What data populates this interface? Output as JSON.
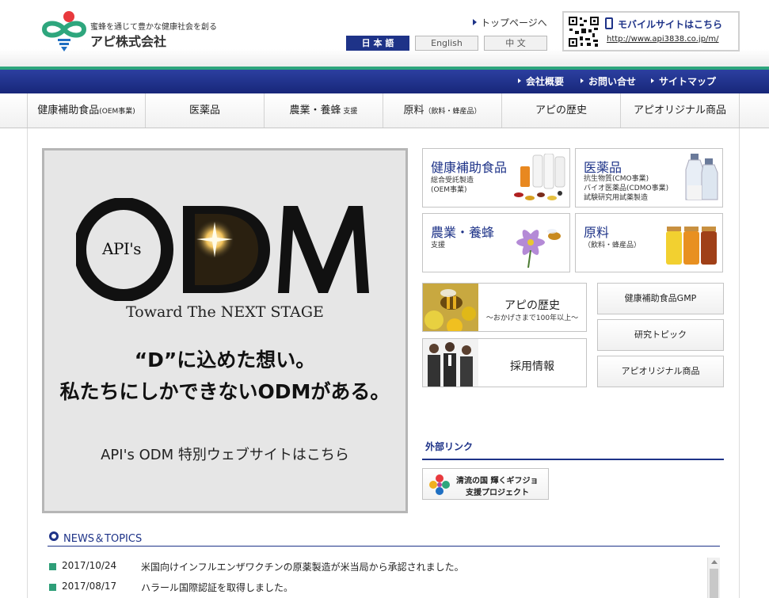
{
  "header": {
    "tagline": "蜜蜂を通じて豊かな健康社会を創る",
    "company": "アピ株式会社",
    "toppage_link": "トップページへ",
    "languages": [
      "日 本 語",
      "English",
      "中 文"
    ],
    "mobile_title": "モバイルサイトはこちら",
    "mobile_url": "http://www.api3838.co.jp/m/"
  },
  "utility_nav": [
    "会社概要",
    "お問い合せ",
    "サイトマップ"
  ],
  "global_nav": [
    {
      "label": "健康補助食品",
      "sub": "(OEM事業)"
    },
    {
      "label": "医薬品",
      "sub": ""
    },
    {
      "label": "農業・養蜂",
      "sub": " 支援"
    },
    {
      "label": "原料",
      "sub": "（飲料・蜂産品）"
    },
    {
      "label": "アピの歴史",
      "sub": ""
    },
    {
      "label": "アピオリジナル商品",
      "sub": ""
    }
  ],
  "odm_banner": {
    "api": "API's",
    "logo": "ODM",
    "tagline": "Toward The NEXT STAGE",
    "message_line1": "“D”に込めた想い。",
    "message_line2": "私たちにしかできないODMがある。",
    "link": "API's ODM 特別ウェブサイトはこちら"
  },
  "categories": [
    {
      "title": "健康補助食品",
      "desc": [
        "総合受託製造",
        "(OEM事業)"
      ],
      "icon": "supplements-image"
    },
    {
      "title": "医薬品",
      "desc": [
        "抗生物質(CMO事業)",
        "バイオ医薬品(CDMO事業)",
        "試験研究用試薬製造"
      ],
      "icon": "vials-image"
    },
    {
      "title": "農業・養蜂",
      "desc": [
        "支援"
      ],
      "icon": "flower-bee-image"
    },
    {
      "title": "原料",
      "desc": [
        "（飲料・蜂産品）"
      ],
      "icon": "jars-image"
    }
  ],
  "features": [
    {
      "title": "アピの歴史",
      "sub": "～おかげさまで100年以上～",
      "icon": "bee-image"
    },
    {
      "title": "採用情報",
      "sub": "",
      "icon": "people-image"
    }
  ],
  "side_buttons": [
    "健康補助食品GMP",
    "研究トピック",
    "アピオリジナル商品"
  ],
  "external_links": {
    "heading": "外部リンク",
    "gifu_line1": "清流の国 輝くギフジョ",
    "gifu_line2": "支援プロジェクト"
  },
  "news": {
    "heading": "NEWS＆TOPICS",
    "items": [
      {
        "date": "2017/10/24",
        "title": "米国向けインフルエンザワクチンの原薬製造が米当局から承認されました。"
      },
      {
        "date": "2017/08/17",
        "title": "ハラール国際認証を取得しました。"
      }
    ]
  },
  "colors": {
    "brand_blue": "#1e3388",
    "brand_green": "#2ea67d",
    "accent_red": "#e8393d"
  }
}
